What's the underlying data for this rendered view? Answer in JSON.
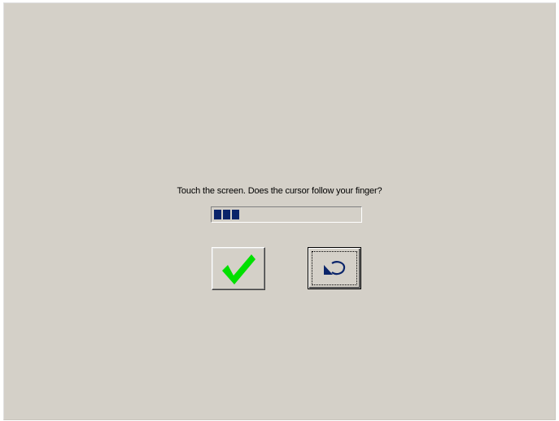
{
  "dialog": {
    "prompt": "Touch the screen. Does the cursor follow your finger?",
    "progress": {
      "filled_segments": 3,
      "fill_color": "#0a246a"
    }
  },
  "buttons": {
    "confirm_icon": "checkmark-icon",
    "confirm_icon_color": "#00e000",
    "back_icon": "undo-arrow-icon",
    "back_icon_color": "#0a246a"
  },
  "colors": {
    "background": "#d4d0c8"
  }
}
